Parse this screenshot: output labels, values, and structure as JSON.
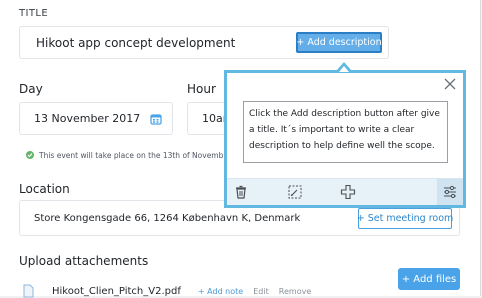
{
  "title_section": {
    "label": "TITLE",
    "value": "Hikoot app concept development",
    "add_description": "+ Add description"
  },
  "date": {
    "day_label": "Day",
    "day_value": "13 November 2017",
    "hour_label": "Hour",
    "hour_value": "10am",
    "note": "This event will take place on the 13th of Novemb"
  },
  "location": {
    "label": "Location",
    "value": "Store Kongensgade 66, 1264 København K, Denmark",
    "set_meeting_room": "+ Set meeting room"
  },
  "attachments": {
    "label": "Upload attachements",
    "add_files": "+ Add files",
    "items": [
      {
        "name": "Hikoot_Clien_Pitch_V2.pdf",
        "add_note": "+ Add note",
        "edit": "Edit",
        "remove": "Remove"
      }
    ]
  },
  "popover": {
    "text": "Click the Add description button after give a title. It´s important to write a clear description to help define well the scope.",
    "tools": [
      "trash-icon",
      "crop-select-icon",
      "move-icon",
      "sliders-icon"
    ]
  },
  "colors": {
    "accent": "#4aa3e8",
    "popover_border": "#62b8e0",
    "success": "#63b36b"
  }
}
